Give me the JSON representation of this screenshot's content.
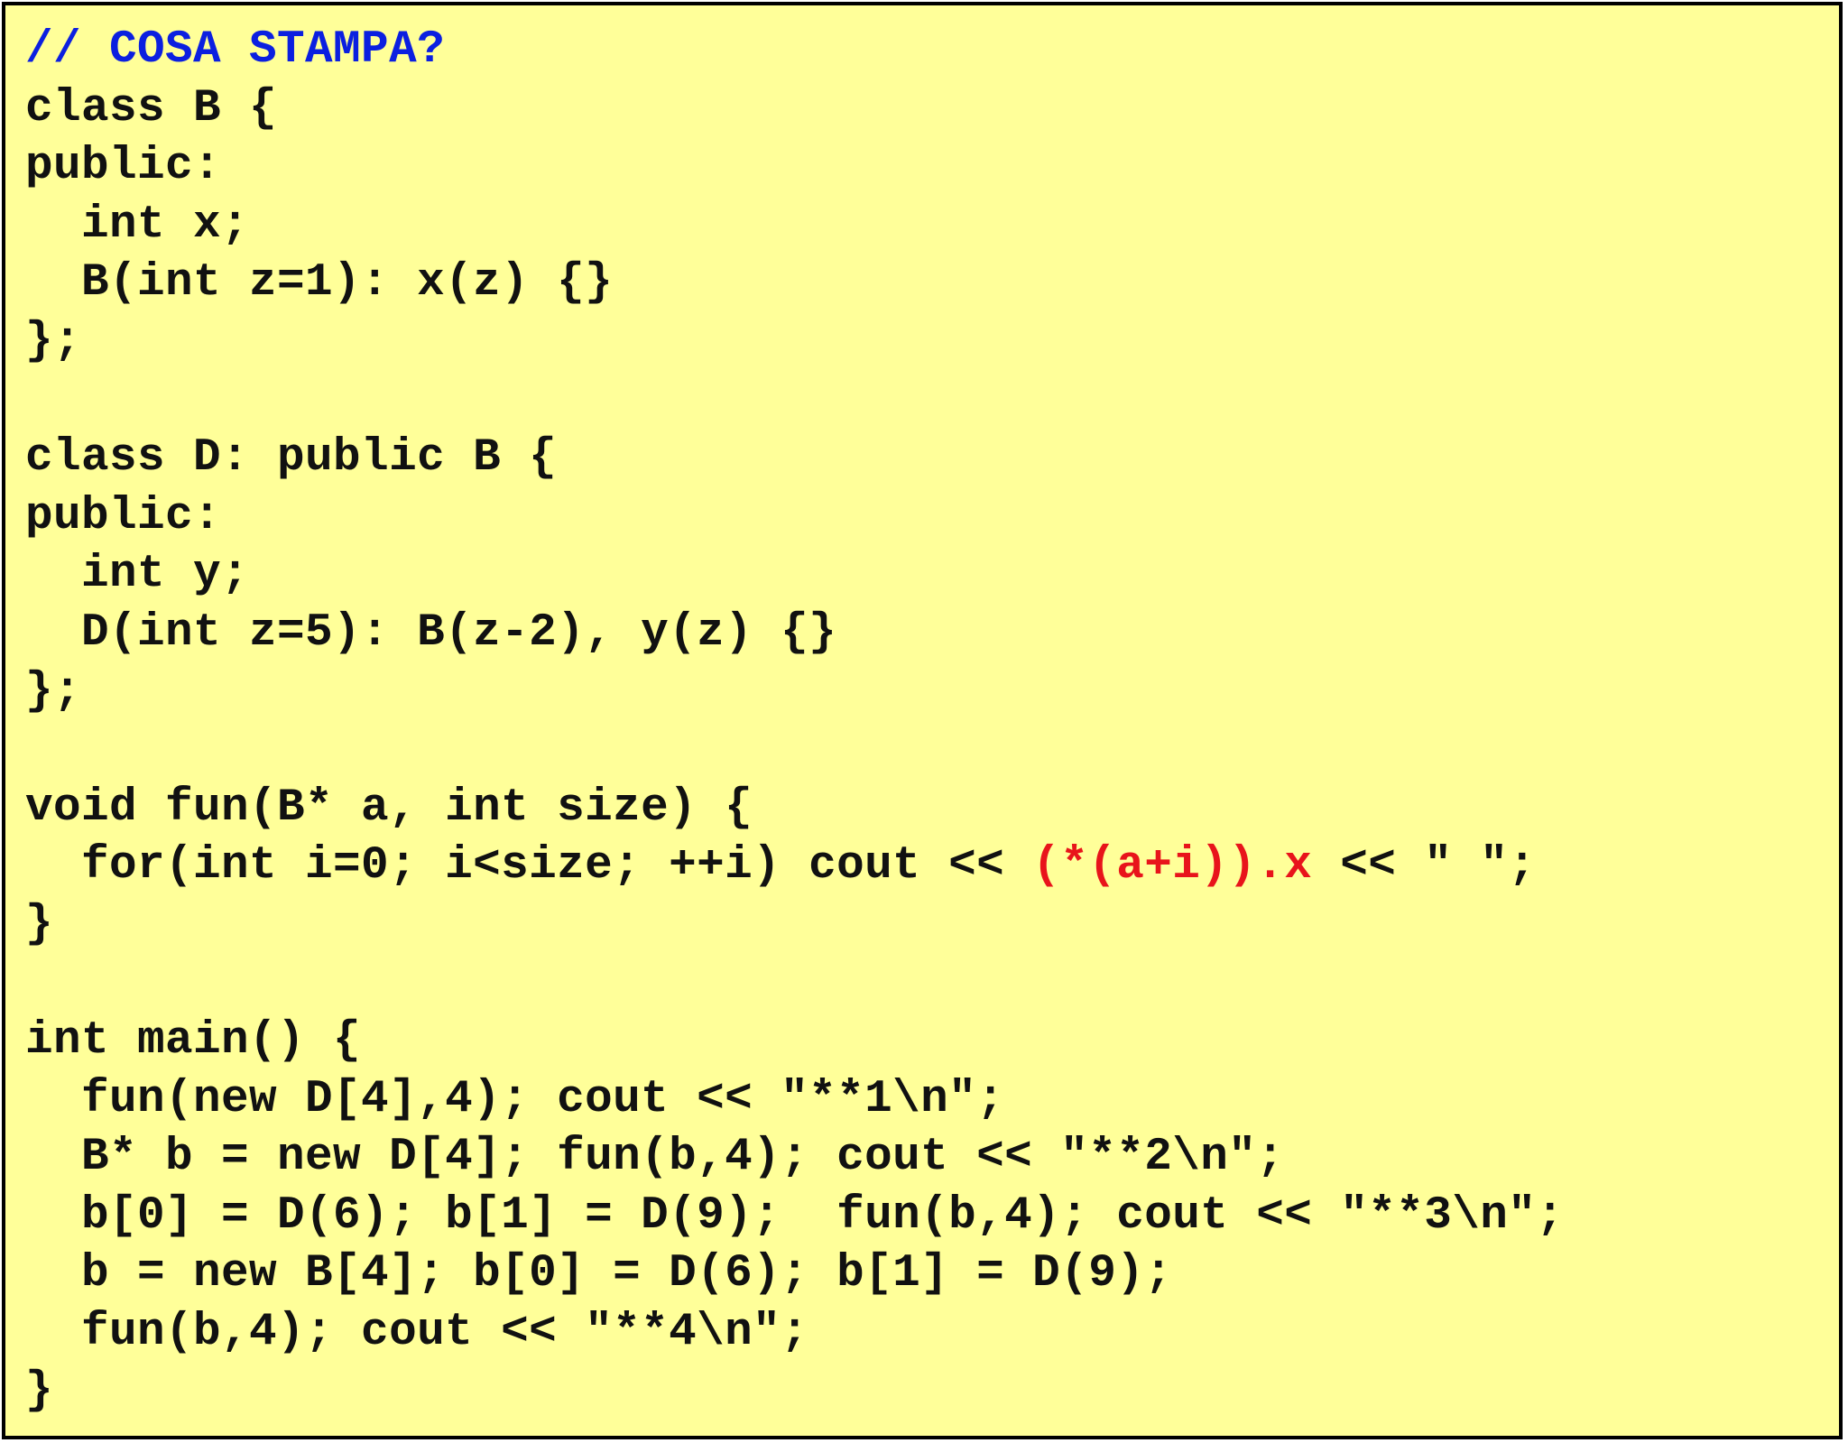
{
  "colors": {
    "background": "#ffff99",
    "border": "#000000",
    "text": "#111111",
    "comment": "#0b1fe0",
    "highlight": "#e8141b"
  },
  "code": {
    "lines": [
      [
        {
          "text": "// COSA STAMPA?",
          "style": "comment"
        }
      ],
      [
        {
          "text": "class B {",
          "style": "plain"
        }
      ],
      [
        {
          "text": "public:",
          "style": "plain"
        }
      ],
      [
        {
          "text": "  int x;",
          "style": "plain"
        }
      ],
      [
        {
          "text": "  B(int z=1): x(z) {}",
          "style": "plain"
        }
      ],
      [
        {
          "text": "};",
          "style": "plain"
        }
      ],
      [
        {
          "text": "",
          "style": "plain"
        }
      ],
      [
        {
          "text": "class D: public B {",
          "style": "plain"
        }
      ],
      [
        {
          "text": "public:",
          "style": "plain"
        }
      ],
      [
        {
          "text": "  int y;",
          "style": "plain"
        }
      ],
      [
        {
          "text": "  D(int z=5): B(z-2), y(z) {}",
          "style": "plain"
        }
      ],
      [
        {
          "text": "};",
          "style": "plain"
        }
      ],
      [
        {
          "text": "",
          "style": "plain"
        }
      ],
      [
        {
          "text": "void fun(B* a, int size) {",
          "style": "plain"
        }
      ],
      [
        {
          "text": "  for(int i=0; i<size; ++i) cout << ",
          "style": "plain"
        },
        {
          "text": "(*(a+i)).x",
          "style": "highlight"
        },
        {
          "text": " << \" \";",
          "style": "plain"
        }
      ],
      [
        {
          "text": "}",
          "style": "plain"
        }
      ],
      [
        {
          "text": "",
          "style": "plain"
        }
      ],
      [
        {
          "text": "int main() {",
          "style": "plain"
        }
      ],
      [
        {
          "text": "  fun(new D[4],4); cout << \"**1\\n\";",
          "style": "plain"
        }
      ],
      [
        {
          "text": "  B* b = new D[4]; fun(b,4); cout << \"**2\\n\";",
          "style": "plain"
        }
      ],
      [
        {
          "text": "  b[0] = D(6); b[1] = D(9);  fun(b,4); cout << \"**3\\n\";",
          "style": "plain"
        }
      ],
      [
        {
          "text": "  b = new B[4]; b[0] = D(6); b[1] = D(9);",
          "style": "plain"
        }
      ],
      [
        {
          "text": "  fun(b,4); cout << \"**4\\n\";",
          "style": "plain"
        }
      ],
      [
        {
          "text": "}",
          "style": "plain"
        }
      ]
    ]
  }
}
